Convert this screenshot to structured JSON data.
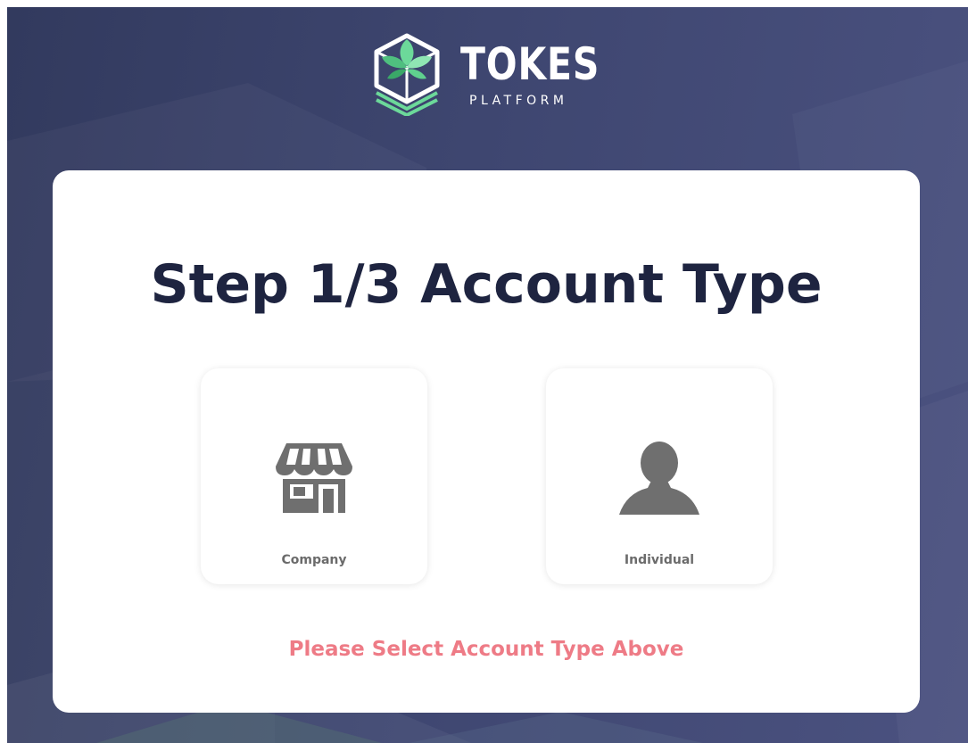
{
  "brand": {
    "name": "TOKES",
    "tagline": "PLATFORM",
    "logo_icon": "cube-leaf-logo"
  },
  "step": {
    "title": "Step 1/3 Account Type"
  },
  "account_options": [
    {
      "label": "Company",
      "icon": "storefront-icon"
    },
    {
      "label": "Individual",
      "icon": "person-icon"
    }
  ],
  "hint": {
    "text": "Please Select Account Type Above"
  },
  "colors": {
    "background": "#3e4670",
    "title": "#1e2440",
    "icon": "#6f6f6f",
    "hint": "#ee7b86",
    "logo_green": "#6cd99a"
  }
}
